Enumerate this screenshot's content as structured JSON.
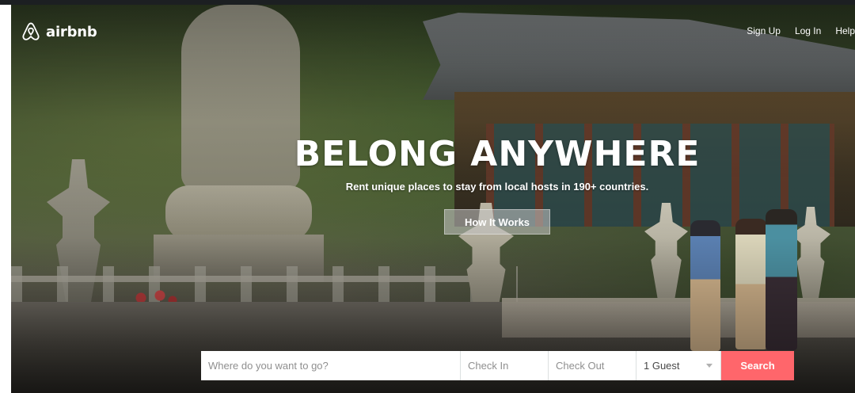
{
  "brand": {
    "name": "airbnb",
    "color": "#ff5a5f",
    "icon": "airbnb-belo-logo-icon"
  },
  "nav": {
    "sign_up": "Sign Up",
    "log_in": "Log In",
    "help": "Help"
  },
  "hero": {
    "headline": "BELONG ANYWHERE",
    "subheadline": "Rent unique places to stay from local hosts in 190+ countries.",
    "how_it_works": "How It Works"
  },
  "search": {
    "where_placeholder": "Where do you want to go?",
    "check_in_placeholder": "Check In",
    "check_out_placeholder": "Check Out",
    "guests_value": "1 Guest",
    "button_label": "Search"
  }
}
